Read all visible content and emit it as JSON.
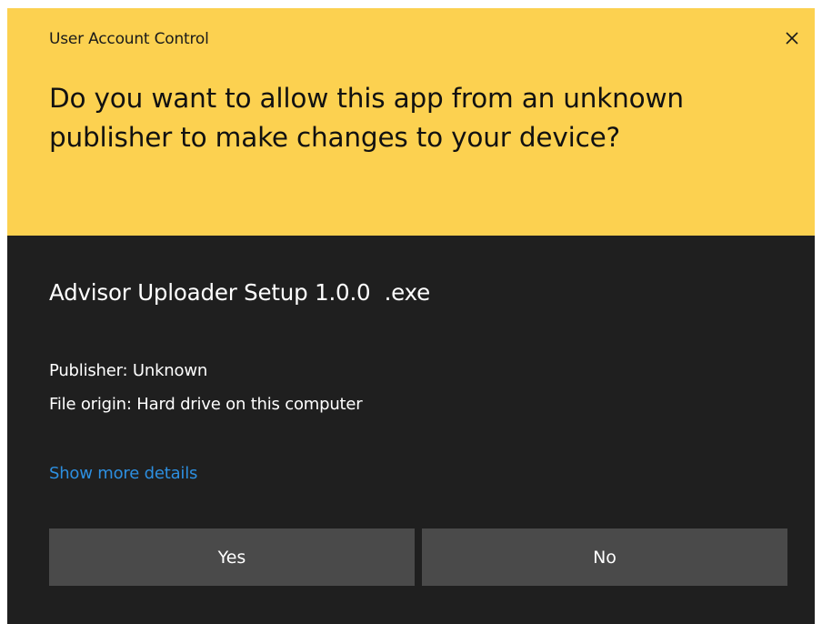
{
  "window": {
    "title": "User Account Control",
    "close_icon": "close-icon"
  },
  "header": {
    "question": "Do you want to allow this app from an unknown publisher to make changes to your device?",
    "background_color": "#fcd150"
  },
  "app": {
    "name": "Advisor Uploader Setup 1.0.0  .exe",
    "publisher": "Publisher: Unknown",
    "origin": "File origin: Hard drive on this computer"
  },
  "links": {
    "show_details": "Show more details"
  },
  "buttons": {
    "yes": "Yes",
    "no": "No"
  },
  "colors": {
    "body_background": "#1f1f1f",
    "button_background": "#4a4a4a",
    "link": "#2d8fe0"
  }
}
